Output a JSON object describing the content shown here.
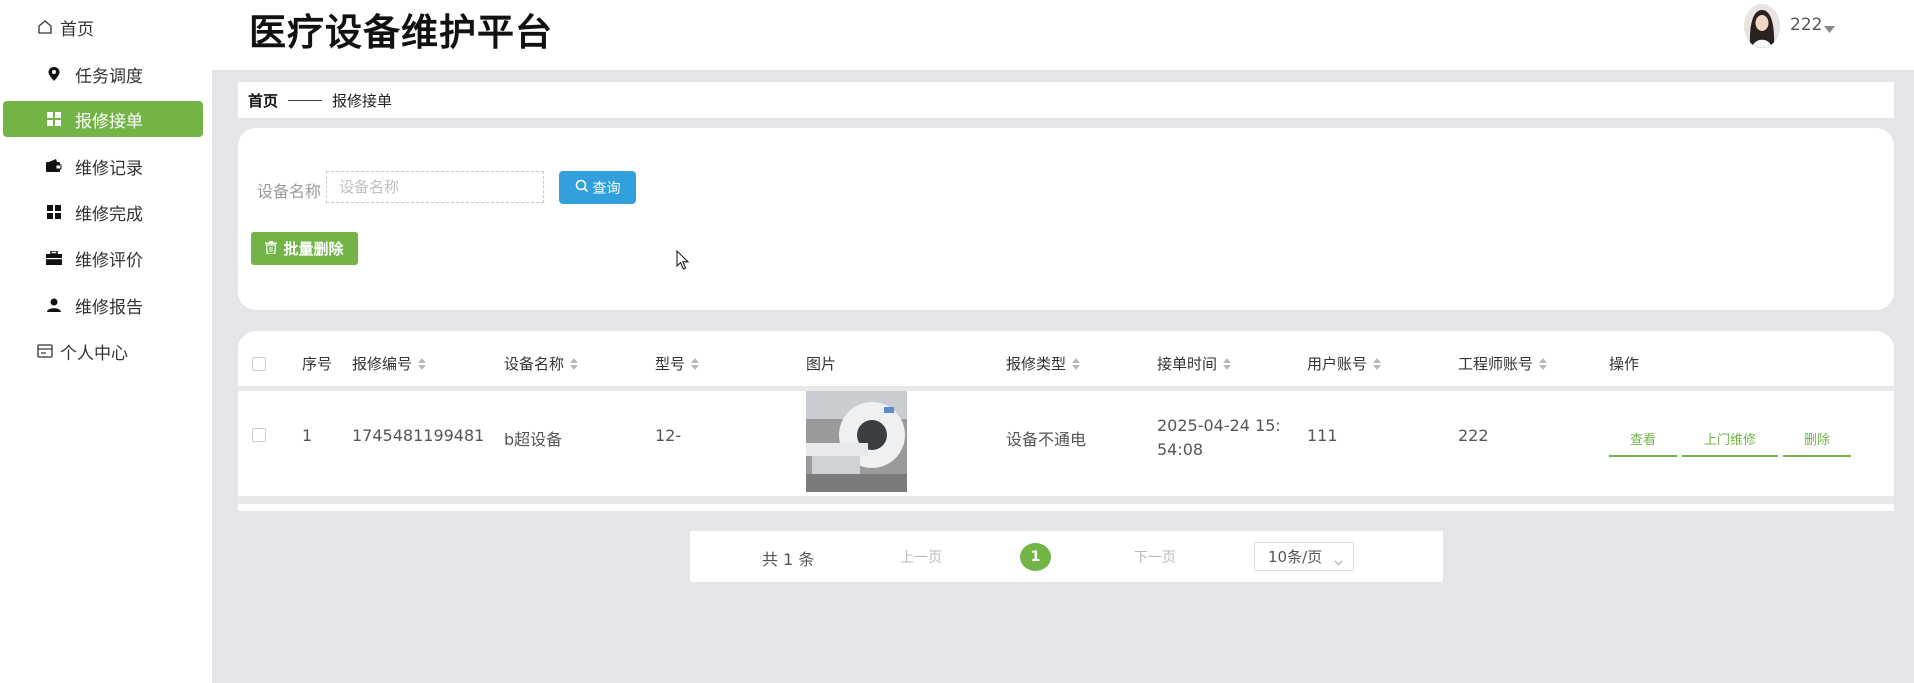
{
  "app": {
    "title": "医疗设备维护平台"
  },
  "user": {
    "name": "222"
  },
  "sidebar": {
    "items": [
      {
        "label": "首页",
        "icon": "home-icon"
      },
      {
        "label": "任务调度",
        "icon": "location-pin-icon"
      },
      {
        "label": "报修接单",
        "icon": "grid-icon",
        "active": true
      },
      {
        "label": "维修记录",
        "icon": "wallet-icon"
      },
      {
        "label": "维修完成",
        "icon": "grid-icon"
      },
      {
        "label": "维修评价",
        "icon": "briefcase-icon"
      },
      {
        "label": "维修报告",
        "icon": "user-icon"
      },
      {
        "label": "个人中心",
        "icon": "card-icon"
      }
    ]
  },
  "breadcrumb": {
    "home": "首页",
    "current": "报修接单"
  },
  "search": {
    "label": "设备名称",
    "placeholder": "设备名称",
    "value": "",
    "button": "查询",
    "bulk_delete": "批量删除"
  },
  "table": {
    "headers": [
      "序号",
      "报修编号",
      "设备名称",
      "型号",
      "图片",
      "报修类型",
      "接单时间",
      "用户账号",
      "工程师账号",
      "操作"
    ],
    "rows": [
      {
        "index": "1",
        "repair_no": "1745481199481",
        "device_name": "b超设备",
        "model": "12-",
        "repair_type": "设备不通电",
        "time_line1": "2025-04-24 15:",
        "time_line2": "54:08",
        "user_account": "111",
        "engineer_account": "222",
        "actions": [
          "查看",
          "上门维修",
          "删除"
        ]
      }
    ]
  },
  "pagination": {
    "total": "共 1 条",
    "prev": "上一页",
    "current": "1",
    "next": "下一页",
    "page_size": "10条/页"
  },
  "colors": {
    "accent": "#72b446",
    "primary": "#31a0dc",
    "background": "#e6e4e8"
  }
}
